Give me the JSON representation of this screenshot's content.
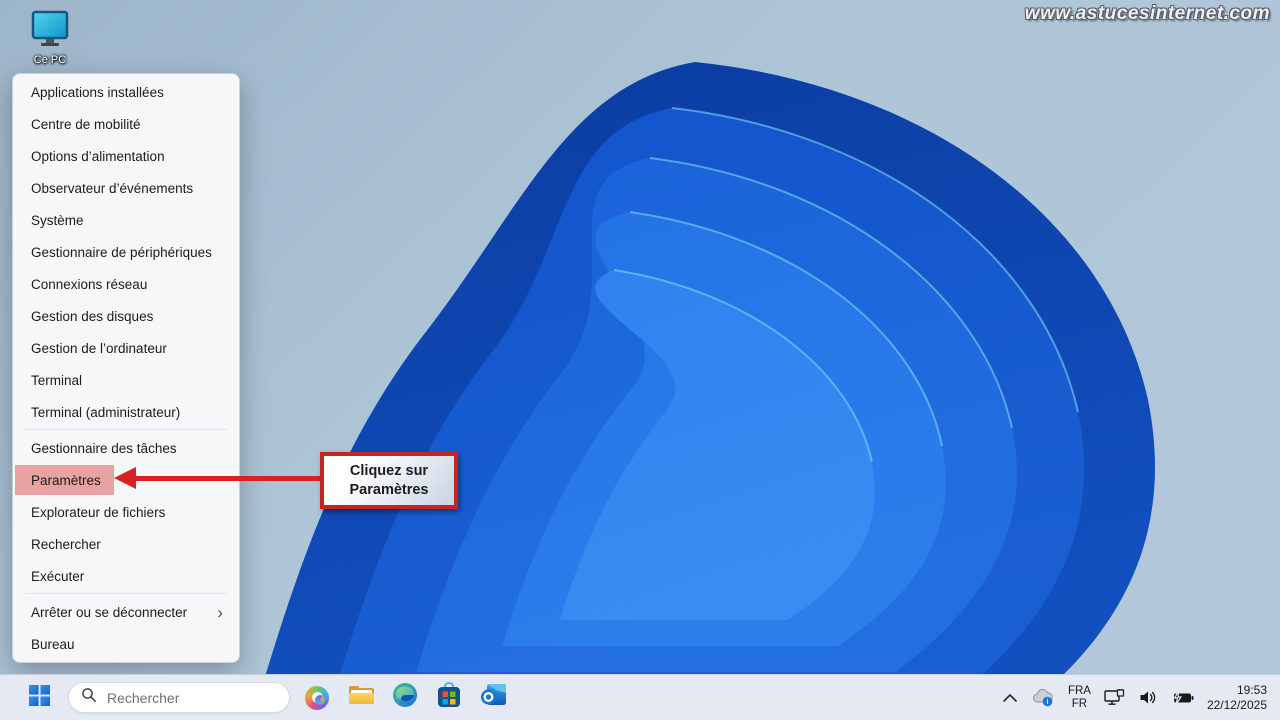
{
  "watermark": "www.astucesinternet.com",
  "desktop": {
    "icon_label": "Ce PC"
  },
  "menu": {
    "group1": [
      "Applications installées",
      "Centre de mobilité",
      "Options d’alimentation",
      "Observateur d’événements",
      "Système",
      "Gestionnaire de périphériques",
      "Connexions réseau",
      "Gestion des disques",
      "Gestion de l’ordinateur",
      "Terminal",
      "Terminal (administrateur)"
    ],
    "group2": [
      "Gestionnaire des tâches",
      "Paramètres",
      "Explorateur de fichiers",
      "Rechercher",
      "Exécuter"
    ],
    "group3": [
      "Arrêter ou se déconnecter",
      "Bureau"
    ],
    "submenu_chevron": "›",
    "highlighted_item": "Paramètres"
  },
  "annotation": {
    "line1": "Cliquez sur",
    "line2": "Paramètres"
  },
  "taskbar": {
    "search_placeholder": "Rechercher",
    "tray": {
      "language_top": "FRA",
      "language_bottom": "FR",
      "time": "19:53",
      "date": "22/12/2025"
    }
  },
  "icons": {
    "start": "windows-logo-icon",
    "search": "magnifier-icon",
    "copilot": "copilot-swirl-icon",
    "explorer": "folder-icon",
    "edge": "edge-swirl-icon",
    "store": "store-bag-icon",
    "outlook": "outlook-envelope-icon",
    "tray_chevron": "chevron-up-icon",
    "cloud": "cloud-info-icon",
    "network": "ethernet-monitor-icon",
    "volume": "speaker-icon",
    "battery": "battery-charging-icon"
  },
  "colors": {
    "highlight_pink": "#e9a2a2",
    "annotation_red": "#c82323",
    "arrow_red": "#d92121",
    "menu_background": "#f6f7f9",
    "taskbar_background": "#e5e9f3",
    "desktop_sky": "#a9c0d4",
    "bloom_blue": "#1a63da"
  }
}
